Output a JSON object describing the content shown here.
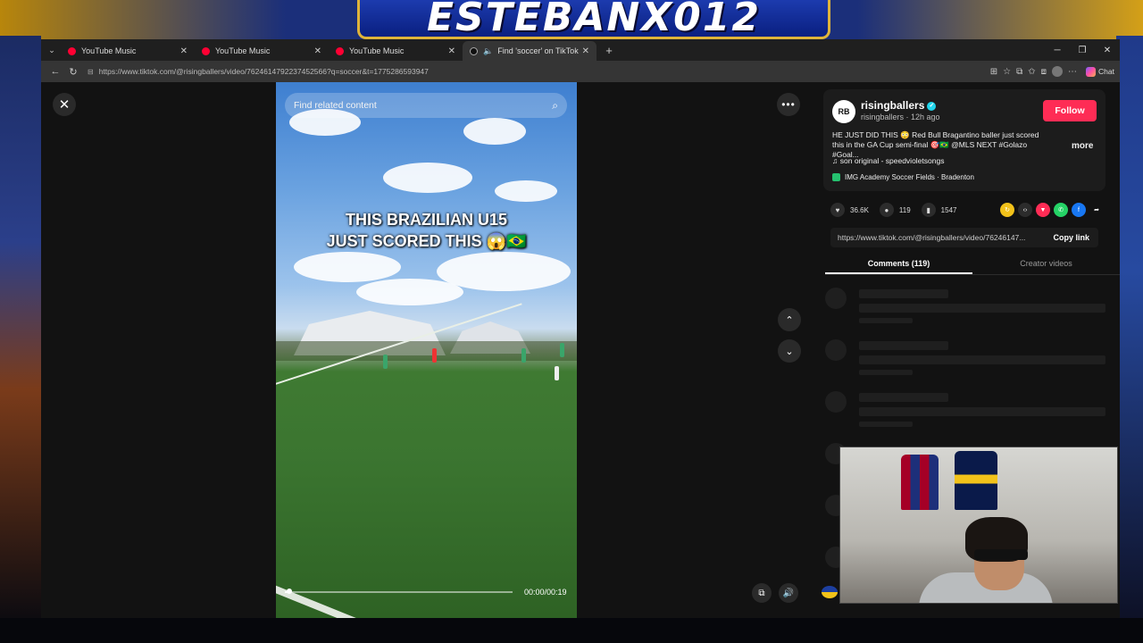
{
  "overlay": {
    "banner_text": "ESTEBANX012"
  },
  "browser": {
    "tabs": [
      {
        "title": "YouTube Music",
        "active": false
      },
      {
        "title": "YouTube Music",
        "active": false
      },
      {
        "title": "YouTube Music",
        "active": false
      },
      {
        "title": "Find 'soccer' on TikTok | TikTo",
        "active": true
      }
    ],
    "new_tab": "+",
    "url": "https://www.tiktok.com/@risingballers/video/7624614792237452566?q=soccer&t=1775286593947",
    "chat_label": "Chat"
  },
  "player": {
    "search_placeholder": "Find related content",
    "caption_line1": "THIS BRAZILIAN U15",
    "caption_line2": "JUST SCORED THIS 😱🇧🇷",
    "time": "00:00/00:19",
    "progress": 0.02
  },
  "post": {
    "author": "risingballers",
    "author_avatar_text": "RB",
    "meta": "risingballers · 12h ago",
    "follow_label": "Follow",
    "description": "HE JUST DID THIS 😳 Red Bull Bragantino baller just scored this in the GA Cup semi-final 🎯🇧🇷 @MLS NEXT #Golazo #Goal...",
    "more_label": "more",
    "music": "son original - speedvioletsongs",
    "location": "IMG Academy Soccer Fields · Bradenton",
    "likes": "36.6K",
    "comments": "119",
    "saves": "1547",
    "link": "https://www.tiktok.com/@risingballers/video/76246147...",
    "copy_label": "Copy link",
    "tabs": {
      "comments": "Comments (119)",
      "creator": "Creator videos"
    }
  }
}
